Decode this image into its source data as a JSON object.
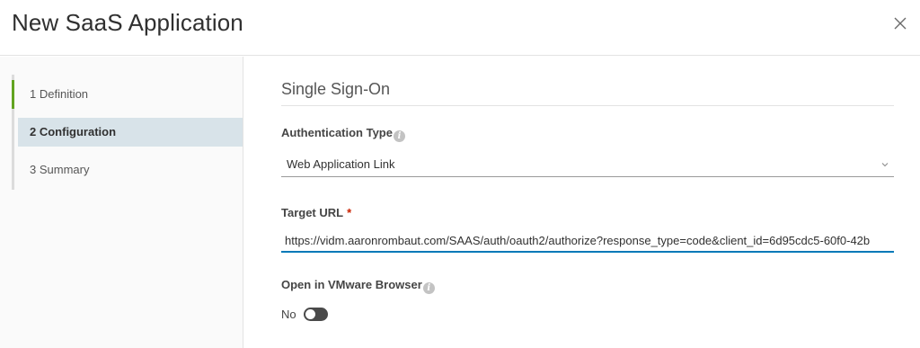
{
  "modal": {
    "title": "New SaaS Application",
    "close_icon": "close-icon"
  },
  "steps": [
    {
      "label": "1  Definition",
      "state": "complete"
    },
    {
      "label": "2  Configuration",
      "state": "active"
    },
    {
      "label": "3  Summary",
      "state": "pending"
    }
  ],
  "section": {
    "title": "Single Sign-On"
  },
  "auth_type": {
    "label": "Authentication Type",
    "info_icon": "info-icon",
    "value": "Web Application Link"
  },
  "target_url": {
    "label": "Target URL",
    "required_mark": "*",
    "value": "https://vidm.aaronrombaut.com/SAAS/auth/oauth2/authorize?response_type=code&client_id=6d95cdc5-60f0-42b"
  },
  "vmware_browser": {
    "label": "Open in VMware Browser",
    "info_icon": "info-icon",
    "toggle_text": "No",
    "enabled": false
  },
  "colors": {
    "accent_blue": "#0079b8",
    "step_done_green": "#62a420",
    "active_step_bg": "#d8e3e9"
  }
}
